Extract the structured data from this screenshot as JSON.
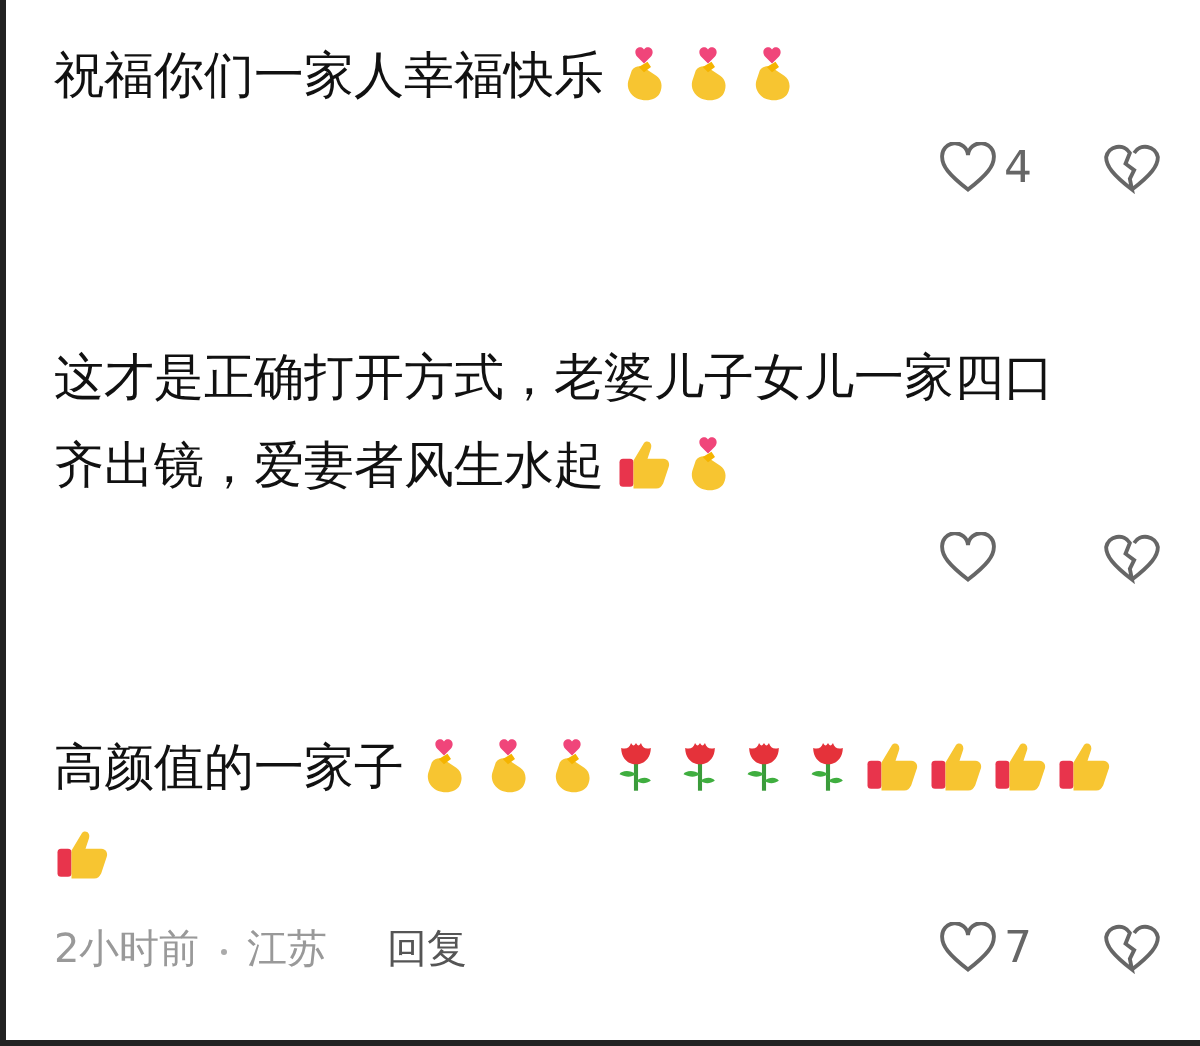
{
  "comments": [
    {
      "lines": [
        "祝福你们一家人幸福快乐"
      ],
      "emoji": [
        {
          "kind": "finger-heart"
        },
        {
          "kind": "finger-heart"
        },
        {
          "kind": "finger-heart"
        }
      ],
      "likes": "4"
    },
    {
      "lines": [
        "这才是正确打开方式，老婆儿子女儿一家四口",
        "齐出镜，爱妻者风生水起"
      ],
      "emoji": [
        {
          "kind": "thumbs-up"
        },
        {
          "kind": "finger-heart"
        }
      ]
    },
    {
      "lines": [
        "高颜值的一家子"
      ],
      "emoji": [
        {
          "kind": "finger-heart"
        },
        {
          "kind": "finger-heart"
        },
        {
          "kind": "finger-heart"
        },
        {
          "kind": "rose"
        },
        {
          "kind": "rose"
        },
        {
          "kind": "rose"
        },
        {
          "kind": "rose"
        },
        {
          "kind": "thumbs-up"
        },
        {
          "kind": "thumbs-up"
        },
        {
          "kind": "thumbs-up"
        },
        {
          "kind": "thumbs-up"
        },
        {
          "kind": "thumbs-up"
        }
      ],
      "time": "2小时前",
      "location": "江苏",
      "reply": "回复",
      "likes": "7"
    }
  ]
}
